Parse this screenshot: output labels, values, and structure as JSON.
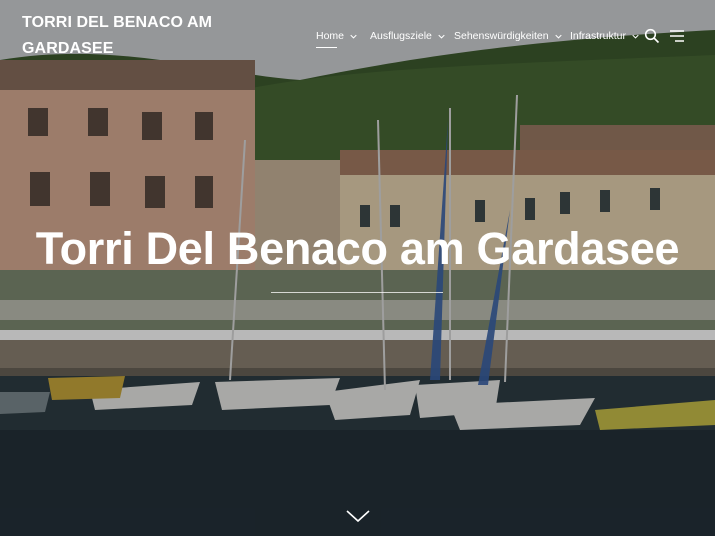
{
  "site": {
    "title": "TORRI DEL BENACO AM GARDASEE"
  },
  "nav": {
    "items": [
      {
        "label": "Home",
        "active": true
      },
      {
        "label": "Ausflugsziele",
        "active": false
      },
      {
        "label": "Sehenswürdigkeiten",
        "active": false
      },
      {
        "label": "Infrastruktur",
        "active": false
      }
    ]
  },
  "icons": {
    "search": "search-icon",
    "menu": "menu-icon",
    "scroll": "chevron-down-icon"
  },
  "hero": {
    "title": "Torri Del Benaco am Gardasee"
  },
  "colors": {
    "text": "#ffffff",
    "hill": "#3d5a2e",
    "water": "#2f3e44",
    "building_light": "#e8d7bb"
  }
}
